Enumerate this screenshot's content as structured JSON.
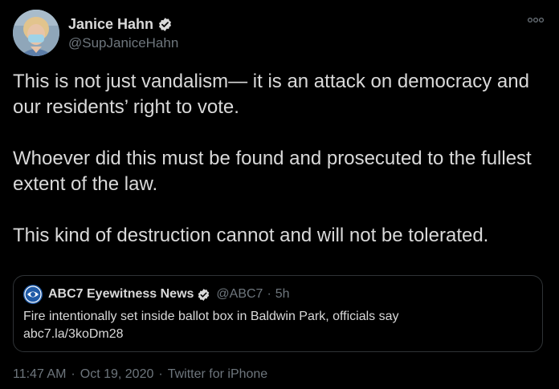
{
  "author": {
    "display_name": "Janice Hahn",
    "handle": "@SupJaniceHahn",
    "avatar_icon": "avatar-photo",
    "verified_icon": "verified-badge-icon"
  },
  "tweet": {
    "paragraphs": [
      "This is not just vandalism— it is an attack on democracy and our residents’ right to vote.",
      "Whoever did this must be found and prosecuted to the fullest extent of the law.",
      "This kind of destruction cannot and will not be tolerated."
    ],
    "time": "11:47 AM",
    "date": "Oct 19, 2020",
    "source": "Twitter for iPhone",
    "separator": "·"
  },
  "quoted": {
    "display_name": "ABC7 Eyewitness News",
    "handle": "@ABC7",
    "dot": "·",
    "time_ago": "5h",
    "text_line1": "Fire intentionally set inside ballot box in Baldwin Park, officials say",
    "text_line2": "abc7.la/3koDm28"
  },
  "colors": {
    "background": "#000000",
    "text": "#d9d9d9",
    "muted": "#6e767d",
    "border": "#2f3336",
    "verified": "#d9d9d9"
  }
}
